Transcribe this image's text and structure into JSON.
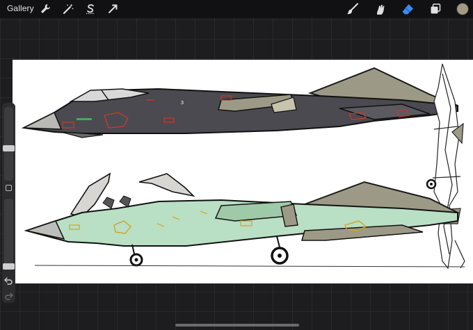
{
  "toolbar": {
    "gallery_label": "Gallery",
    "left_icons": [
      "wrench-icon",
      "magic-wand-icon",
      "selection-s-icon",
      "transform-arrow-icon"
    ],
    "right_icons": [
      "brush-icon",
      "smudge-icon",
      "eraser-icon",
      "layers-icon"
    ],
    "active_tool": "eraser-icon",
    "current_color": "#a39a83"
  },
  "sidebar": {
    "size_slider_level": 0.43,
    "opacity_slider_level": 0.0,
    "icons": [
      "modify-square-icon",
      "undo-icon",
      "redo-icon"
    ]
  },
  "canvas": {
    "background": "#ffffff",
    "content": "jet-fighter-sketch",
    "marking_text": "3",
    "top_jet_color": "#4a4a50",
    "bottom_jet_color": "#b9dfc4",
    "wing_color": "#9c9a86"
  }
}
